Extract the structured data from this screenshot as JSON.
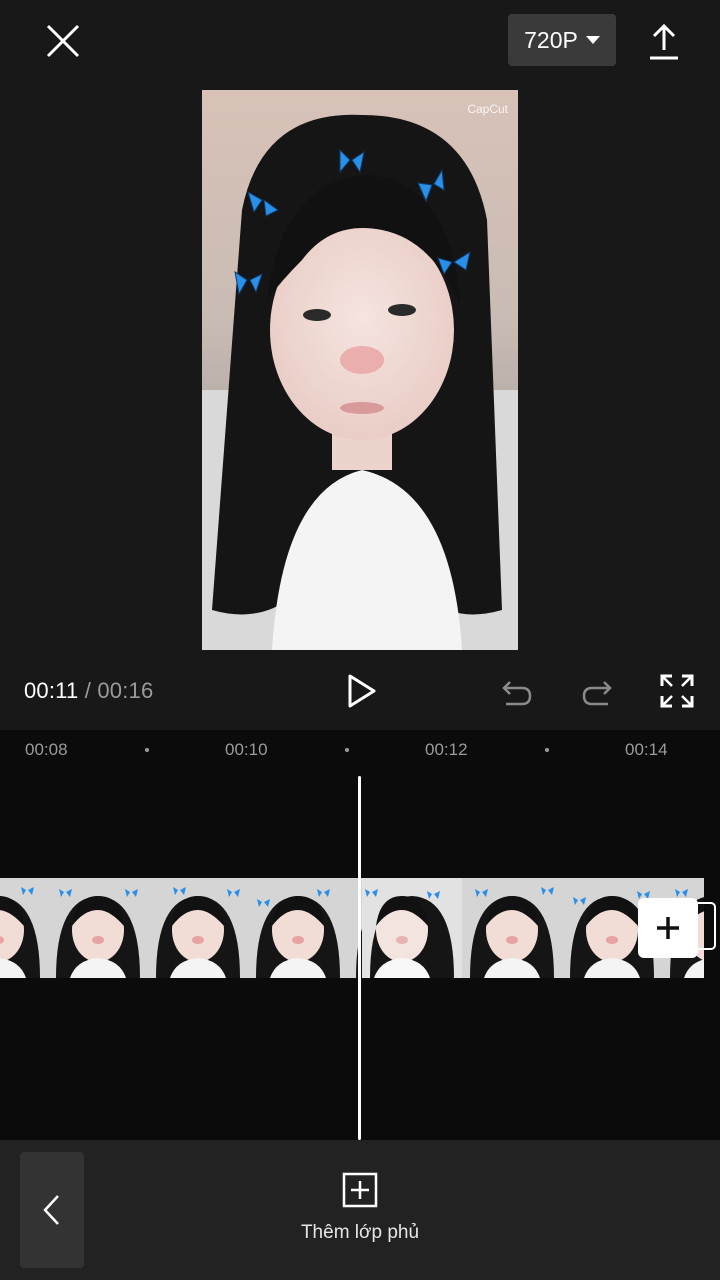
{
  "topbar": {
    "resolution_label": "720P"
  },
  "preview": {
    "watermark": "CapCut"
  },
  "player": {
    "current_time": "00:11",
    "separator": "/",
    "total_time": "00:16"
  },
  "timeline": {
    "ticks": [
      "00:08",
      "00:10",
      "00:12",
      "00:14"
    ]
  },
  "bottom": {
    "add_overlay_label": "Thêm lớp phủ"
  },
  "icons": {
    "close": "close-icon",
    "resolution_caret": "caret-down-icon",
    "export": "export-icon",
    "play": "play-icon",
    "undo": "undo-icon",
    "redo": "redo-icon",
    "fullscreen": "fullscreen-icon",
    "add_clip": "plus-icon",
    "back": "chevron-left-icon",
    "add_overlay": "add-overlay-icon"
  },
  "colors": {
    "background": "#181818",
    "timeline_bg": "#0b0b0b",
    "bottom_bar": "#222222",
    "butterfly": "#2a8fe6"
  }
}
